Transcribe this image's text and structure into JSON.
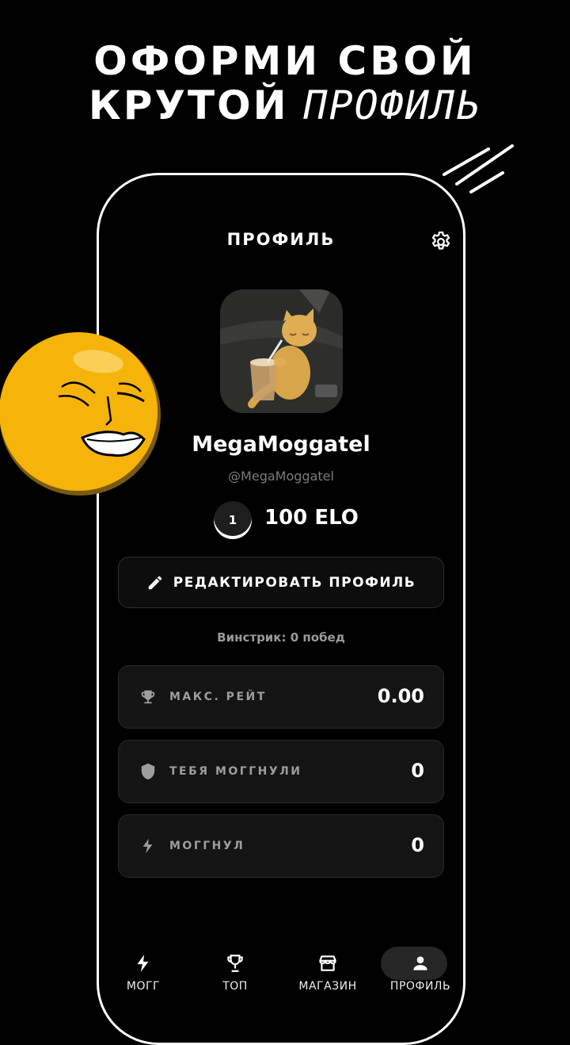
{
  "promo": {
    "line1": "ОФОРМИ СВОЙ",
    "line2_bold": "КРУТОЙ",
    "line2_hand": "ПРОФИЛЬ"
  },
  "header": {
    "title": "ПРОФИЛЬ",
    "settings_icon": "gear-icon"
  },
  "profile": {
    "username": "MegaMoggatel",
    "handle": "@MegaMoggatel",
    "rank": "1",
    "elo": "100 ELO",
    "edit_label": "РЕДАКТИРОВАТЬ ПРОФИЛЬ",
    "winstreak": "Винстрик: 0 побед"
  },
  "stats": [
    {
      "icon": "trophy-icon",
      "label": "МАКС. РЕЙТ",
      "value": "0.00"
    },
    {
      "icon": "shield-icon",
      "label": "ТЕБЯ МОГГНУЛИ",
      "value": "0"
    },
    {
      "icon": "bolt-icon",
      "label": "МОГГНУЛ",
      "value": "0"
    }
  ],
  "nav": [
    {
      "icon": "bolt-icon",
      "label": "МОГГ"
    },
    {
      "icon": "trophy-icon",
      "label": "ТОП"
    },
    {
      "icon": "store-icon",
      "label": "МАГАЗИН"
    },
    {
      "icon": "person-icon",
      "label": "ПРОФИЛЬ",
      "active": true
    }
  ],
  "colors": {
    "background": "#000000",
    "card": "#141414",
    "accent_emoji": "#F6B40A",
    "muted_text": "#9D9D9D"
  }
}
